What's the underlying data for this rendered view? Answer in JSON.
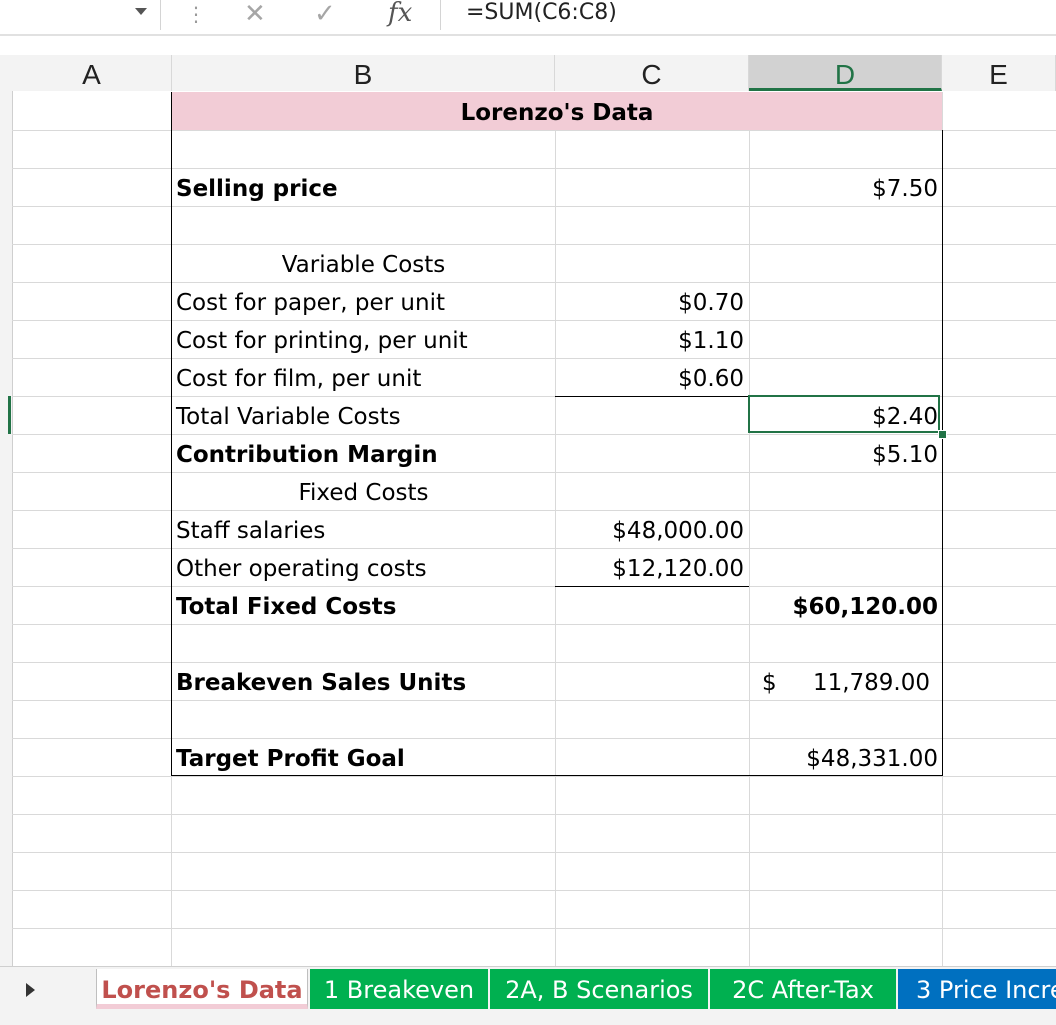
{
  "formula_bar": {
    "formula": "=SUM(C6:C8)",
    "cancel_icon": "cancel-x-icon",
    "enter_icon": "checkmark-icon",
    "fx_label": "fx"
  },
  "columns": [
    "A",
    "B",
    "C",
    "D",
    "E"
  ],
  "sheet": {
    "title": "Lorenzo's Data",
    "rows": {
      "selling_price": {
        "label": "Selling price",
        "d": "$7.50"
      },
      "variable_costs_header": "Variable Costs",
      "paper": {
        "label": "Cost for paper, per unit",
        "c": "$0.70"
      },
      "printing": {
        "label": "Cost for printing, per unit",
        "c": "$1.10"
      },
      "film": {
        "label": "Cost for film, per unit",
        "c": "$0.60"
      },
      "total_variable": {
        "label": "Total Variable Costs",
        "d": "$2.40"
      },
      "contribution_margin": {
        "label": "Contribution Margin",
        "d": "$5.10"
      },
      "fixed_costs_header": "Fixed Costs",
      "staff": {
        "label": "Staff salaries",
        "c": "$48,000.00"
      },
      "other": {
        "label": "Other operating costs",
        "c": "$12,120.00"
      },
      "total_fixed": {
        "label": "Total Fixed Costs",
        "d": "$60,120.00"
      },
      "breakeven": {
        "label": "Breakeven Sales Units",
        "d_symbol": "$",
        "d": "11,789.00"
      },
      "target_profit": {
        "label": "Target Profit Goal",
        "d": "$48,331.00"
      }
    }
  },
  "tabs": [
    {
      "label": "Lorenzo's Data",
      "color": "#f2ccd6",
      "text_color": "#c0504d",
      "active": true
    },
    {
      "label": "1 Breakeven",
      "color": "#00b050",
      "text_color": "#ffffff",
      "active": false
    },
    {
      "label": "2A, B Scenarios",
      "color": "#00b050",
      "text_color": "#ffffff",
      "active": false
    },
    {
      "label": "2C After-Tax",
      "color": "#00b050",
      "text_color": "#ffffff",
      "active": false
    },
    {
      "label": "3 Price Incre",
      "color": "#0070c0",
      "text_color": "#ffffff",
      "active": false
    }
  ],
  "accent_color": "#217346"
}
